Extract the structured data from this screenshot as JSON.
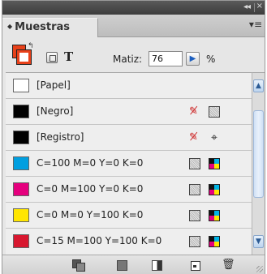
{
  "window": {
    "collapse_glyph": "◂◂",
    "close_glyph": "×"
  },
  "panel": {
    "tab_arrows": "◆",
    "tab_title": "Muestras",
    "menu_glyph": "▾≡"
  },
  "toolbar": {
    "text_label": "T",
    "tint_label": "Matiz:",
    "tint_value": "76",
    "tint_arrow_glyph": "▶",
    "tint_unit": "%"
  },
  "swatches": [
    {
      "name": "[Papel]",
      "color": "#ffffff",
      "icon1": "",
      "icon2": ""
    },
    {
      "name": "[Negro]",
      "color": "#000000",
      "icon1": "no-edit-icon",
      "icon2": "cmyk-icon"
    },
    {
      "name": "[Registro]",
      "color": "#000000",
      "icon1": "no-edit-icon",
      "icon2": "registration-icon"
    },
    {
      "name": "C=100 M=0 Y=0 K=0",
      "color": "#009fe0",
      "icon1": "cmyk-icon",
      "icon2": "process-icon"
    },
    {
      "name": "C=0 M=100 Y=0 K=0",
      "color": "#e5007e",
      "icon1": "cmyk-icon",
      "icon2": "process-icon"
    },
    {
      "name": "C=0 M=0 Y=100 K=0",
      "color": "#ffe600",
      "icon1": "cmyk-icon",
      "icon2": "process-icon"
    },
    {
      "name": "C=15 M=100 Y=100 K=0",
      "color": "#d7172f",
      "icon1": "cmyk-icon",
      "icon2": "process-icon"
    }
  ],
  "scroll": {
    "up_glyph": "▲",
    "down_glyph": "▼"
  },
  "bottom": {
    "delete_glyph": "🗑"
  },
  "colors": {
    "accent_fill_stroke": "#e8411a"
  }
}
